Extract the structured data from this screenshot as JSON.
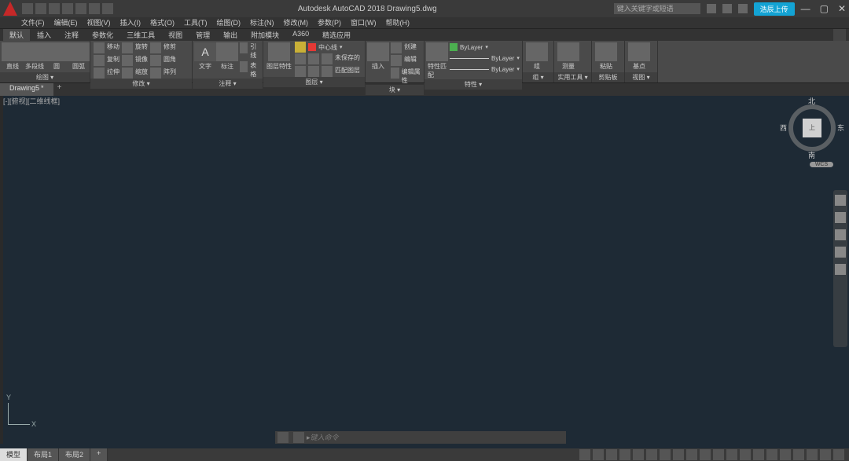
{
  "title": "Autodesk AutoCAD 2018   Drawing5.dwg",
  "search_placeholder": "键入关键字或短语",
  "cloud_button": "浩辰上传",
  "menu": [
    "文件(F)",
    "编辑(E)",
    "视图(V)",
    "插入(I)",
    "格式(O)",
    "工具(T)",
    "绘图(D)",
    "标注(N)",
    "修改(M)",
    "参数(P)",
    "窗口(W)",
    "帮助(H)"
  ],
  "ribbon_tabs": [
    "默认",
    "插入",
    "注释",
    "参数化",
    "三维工具",
    "视图",
    "管理",
    "输出",
    "附加模块",
    "A360",
    "精选应用"
  ],
  "ribbon_active": 0,
  "panels": {
    "draw": {
      "label": "绘图 ▾",
      "tools": {
        "line": "直线",
        "polyline": "多段线",
        "circle": "圆",
        "arc": "圆弧"
      }
    },
    "modify": {
      "label": "修改 ▾",
      "tools": {
        "move": "移动",
        "rotate": "旋转",
        "trim": "修剪",
        "copy": "复制",
        "mirror": "镜像",
        "fillet": "圆角",
        "stretch": "拉伸",
        "scale": "缩放",
        "array": "阵列"
      }
    },
    "annotate": {
      "label": "注释 ▾",
      "tools": {
        "text": "文字",
        "dimension": "标注",
        "leader": "引线",
        "table": "表格"
      }
    },
    "layers": {
      "label": "图层 ▾",
      "tools": {
        "layer_props": "图层特性",
        "unsaved": "未保存的",
        "match": "匹配图层"
      },
      "current_layer": "中心线"
    },
    "block": {
      "label": "块 ▾",
      "tools": {
        "insert": "插入",
        "create": "创建",
        "edit": "编辑",
        "edit_attr": "编辑属性"
      }
    },
    "properties": {
      "label": "特性 ▾",
      "tools": {
        "match": "特性匹配",
        "p1": "ByLayer",
        "p2": "ByLayer",
        "p3": "ByLayer"
      }
    },
    "groups": {
      "label": "组 ▾",
      "tool": "组"
    },
    "utilities": {
      "label": "实用工具 ▾",
      "tool": "测量"
    },
    "clipboard": {
      "label": "剪贴板",
      "tool": "粘贴"
    },
    "view": {
      "label": "视图 ▾",
      "tool": "基点"
    }
  },
  "drawing_tab": "Drawing5",
  "viewport_label": "[-][俯视][二维线框]",
  "viewcube": {
    "top": "上",
    "n": "北",
    "e": "东",
    "s": "南",
    "w": "西",
    "wcs": "WCS"
  },
  "axis": {
    "x": "X",
    "y": "Y"
  },
  "command_placeholder": "键入命令",
  "layout_tabs": [
    "模型",
    "布局1",
    "布局2"
  ],
  "layout_active": 0
}
